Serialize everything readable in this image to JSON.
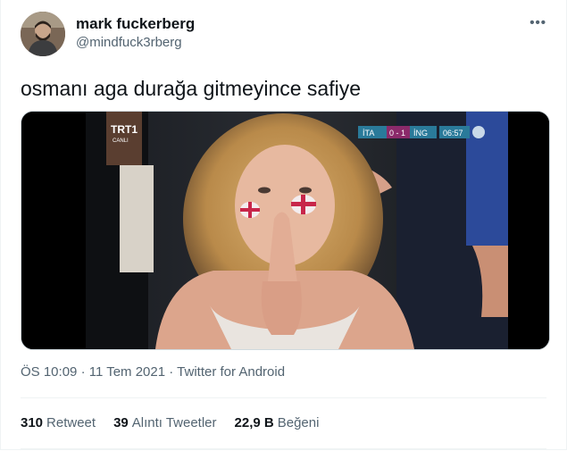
{
  "author": {
    "name": "mark fuckerberg",
    "handle": "@mindfuck3rberg"
  },
  "tweet": {
    "text": "osmanı aga durağa gitmeyince safiye"
  },
  "media": {
    "channel": "TRT1",
    "channel_sub": "CANLI",
    "score": {
      "team1": "İTA",
      "score": "0 - 1",
      "team2": "İNG",
      "time": "06:57"
    }
  },
  "meta": {
    "time": "ÖS 10:09",
    "date": "11 Tem 2021",
    "client": "Twitter for Android",
    "sep": "·"
  },
  "stats": {
    "retweets": {
      "count": "310",
      "label": "Retweet"
    },
    "quotes": {
      "count": "39",
      "label": "Alıntı Tweetler"
    },
    "likes": {
      "count": "22,9 B",
      "label": "Beğeni"
    }
  },
  "colors": {
    "secondary_text": "#536471",
    "divider": "#eff3f4",
    "score_bg": "#2a7a9a"
  }
}
